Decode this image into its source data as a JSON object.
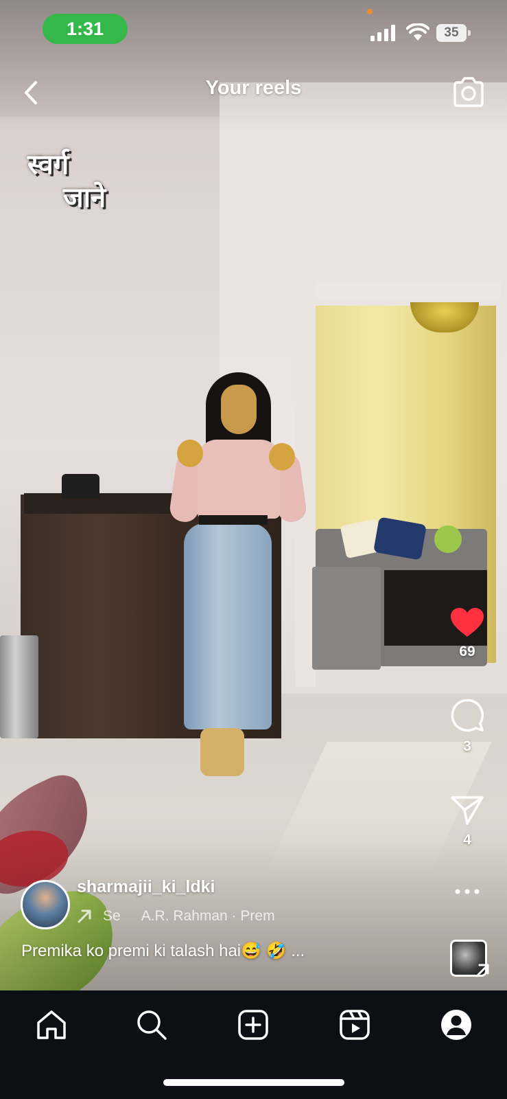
{
  "status_bar": {
    "time": "1:31",
    "battery": "35"
  },
  "header": {
    "title": "Your reels",
    "back_icon": "chevron-left-icon",
    "camera_icon": "camera-icon"
  },
  "video_overlay": {
    "line1": "स्वर्ग",
    "line2": "जाने"
  },
  "actions": {
    "likes": "69",
    "comments": "3",
    "shares": "4",
    "like_color": "#ff3040"
  },
  "post": {
    "username": "sharmajii_ki_ldki",
    "audio_prefix": "Se",
    "audio_text": "A.R. Rahman · Prem",
    "caption": "Premika ko premi ki talash hai😅 🤣 ..."
  },
  "nav": {
    "items": [
      "home-icon",
      "search-icon",
      "create-icon",
      "reels-icon",
      "profile-icon"
    ]
  },
  "colors": {
    "status_pill": "#35b84a",
    "nav_bg": "#0c0f14"
  }
}
